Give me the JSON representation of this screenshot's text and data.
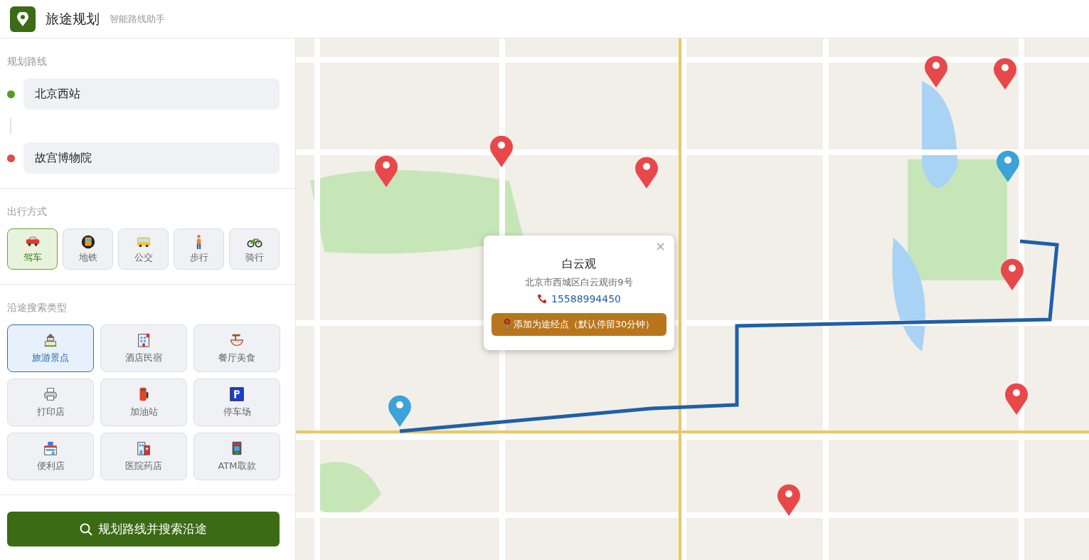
{
  "header": {
    "title": "旅途规划",
    "subtitle": "智能路线助手"
  },
  "route": {
    "label": "规划路线",
    "stops": [
      {
        "value": "北京西站",
        "color": "#5a9a1f"
      },
      {
        "value": "故宫博物院",
        "color": "#e04b4b"
      }
    ]
  },
  "travel_modes": {
    "label": "出行方式",
    "items": [
      {
        "label": "驾车",
        "selected": true
      },
      {
        "label": "地铁",
        "selected": false
      },
      {
        "label": "公交",
        "selected": false
      },
      {
        "label": "步行",
        "selected": false
      },
      {
        "label": "骑行",
        "selected": false
      }
    ]
  },
  "search_types": {
    "label": "沿途搜索类型",
    "items": [
      {
        "label": "旅游景点",
        "selected": true
      },
      {
        "label": "酒店民宿",
        "selected": false
      },
      {
        "label": "餐厅美食",
        "selected": false
      },
      {
        "label": "打印店",
        "selected": false
      },
      {
        "label": "加油站",
        "selected": false
      },
      {
        "label": "停车场",
        "selected": false
      },
      {
        "label": "便利店",
        "selected": false
      },
      {
        "label": "医院药店",
        "selected": false
      },
      {
        "label": "ATM取款",
        "selected": false
      }
    ]
  },
  "plan_button": "规划路线并搜索沿途",
  "map": {
    "popup": {
      "close": "×",
      "title": "白云观",
      "address": "北京市西城区白云观街9号",
      "phone": "15588994450",
      "button": "添加为途经点（默认停留30分钟）"
    }
  }
}
